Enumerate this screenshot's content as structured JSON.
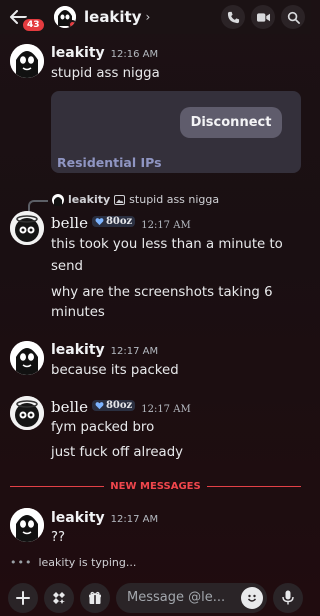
{
  "header": {
    "title": "leakity",
    "badge_count": "43",
    "chevron": "›",
    "icons": [
      "back-arrow-icon",
      "phone-call-icon",
      "video-icon",
      "search-icon"
    ]
  },
  "messages": [
    {
      "author": "leakity",
      "time": "12:16 AM",
      "lines": [
        "stupid ass nigga"
      ]
    },
    {
      "reply_author": "leakity",
      "reply_text": "stupid ass nigga",
      "author": "belle",
      "tag": "80oz",
      "time": "12:17 AM",
      "lines": [
        "this took you less than a minute to",
        "send",
        "why are the screenshots taking 6",
        "minutes"
      ]
    },
    {
      "author": "leakity",
      "time": "12:17 AM",
      "lines": [
        "because its packed"
      ]
    },
    {
      "author": "belle",
      "tag": "80oz",
      "time": "12:17 AM",
      "lines": [
        "fym packed bro",
        "just fuck off already"
      ]
    },
    {
      "author": "leakity",
      "time": "12:17 AM",
      "lines": [
        "??"
      ]
    }
  ],
  "embed": {
    "button_label": "Disconnect",
    "label": "Residential IPs"
  },
  "divider": {
    "label": "NEW MESSAGES"
  },
  "typing": {
    "text": "leakity is typing...",
    "dots": "•••"
  },
  "composer": {
    "placeholder": "Message @le...",
    "icons": [
      "plus-icon",
      "apps-icon",
      "gift-icon",
      "emoji-icon",
      "microphone-icon"
    ]
  },
  "colors": {
    "accent_red": "#e43b3f",
    "embed_label": "#8f95c2",
    "new_messages": "#f0464c"
  }
}
